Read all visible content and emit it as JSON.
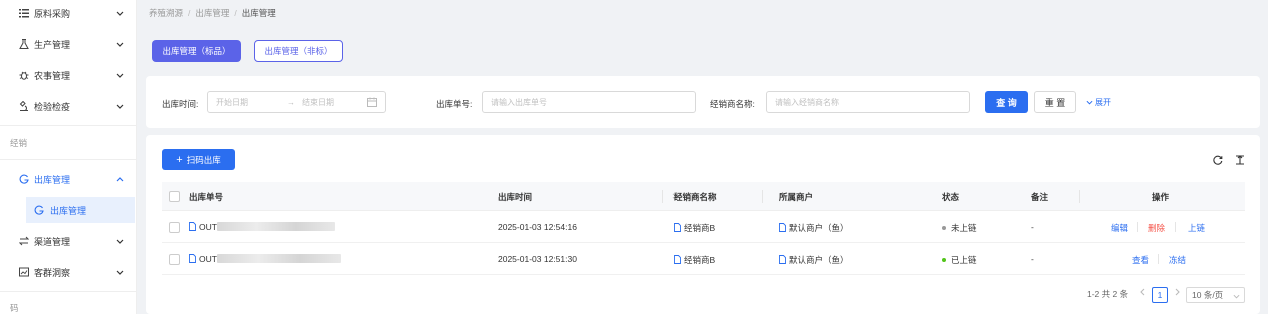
{
  "sidebar": {
    "items": [
      {
        "label": "原料采购",
        "icon": "list-icon"
      },
      {
        "label": "生产管理",
        "icon": "flask-icon"
      },
      {
        "label": "农事管理",
        "icon": "bug-icon"
      },
      {
        "label": "检验检疫",
        "icon": "microscope-icon"
      }
    ],
    "group_label": "经销",
    "outbound": {
      "label": "出库管理",
      "sub_label": "出库管理"
    },
    "channel": {
      "label": "渠道管理"
    },
    "customer": {
      "label": "客群洞察"
    },
    "group2_label": "码"
  },
  "breadcrumb": [
    "养殖溯源",
    "出库管理",
    "出库管理"
  ],
  "tabs": [
    {
      "label": "出库管理（标品）",
      "active": true
    },
    {
      "label": "出库管理（非标）",
      "active": false
    }
  ],
  "search": {
    "time_label": "出库时间:",
    "start_placeholder": "开始日期",
    "arrow": "→",
    "end_placeholder": "结束日期",
    "order_label": "出库单号:",
    "order_placeholder": "请输入出库单号",
    "dealer_label": "经销商名称:",
    "dealer_placeholder": "请输入经销商名称",
    "query_label": "查 询",
    "reset_label": "重 置",
    "expand_label": "展开"
  },
  "toolbar": {
    "scan_label": "扫码出库"
  },
  "table": {
    "headers": [
      "出库单号",
      "出库时间",
      "经销商名称",
      "所属商户",
      "状态",
      "备注",
      "操作"
    ],
    "rows": [
      {
        "order_prefix": "OUT",
        "time": "2025-01-03 12:54:16",
        "dealer": "经销商B",
        "merchant": "默认商户（鱼）",
        "status": "未上链",
        "status_color": "#999999",
        "remark": "-",
        "actions": [
          "编辑",
          "删除",
          "上链"
        ]
      },
      {
        "order_prefix": "OUT",
        "time": "2025-01-03 12:51:30",
        "dealer": "经销商B",
        "merchant": "默认商户（鱼）",
        "status": "已上链",
        "status_color": "#52c41a",
        "remark": "-",
        "actions": [
          "查看",
          "冻结"
        ]
      }
    ]
  },
  "pagination": {
    "summary": "1-2 共 2 条",
    "current_page": "1",
    "page_size": "10 条/页"
  },
  "colors": {
    "primary": "#2b6ef0",
    "tab": "#5b63e8",
    "danger": "#f5544a"
  }
}
